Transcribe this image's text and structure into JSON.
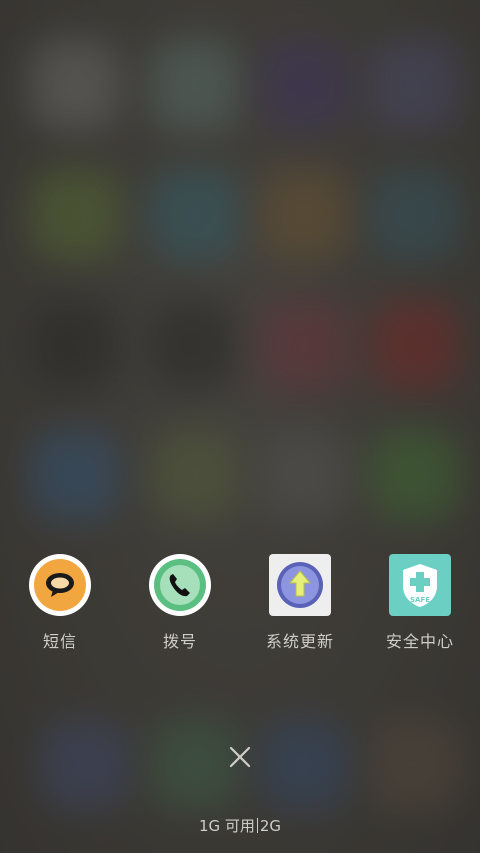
{
  "recent_apps": [
    {
      "label": "短信",
      "icon": "message-bubble-icon"
    },
    {
      "label": "拨号",
      "icon": "phone-handset-icon"
    },
    {
      "label": "系统更新",
      "icon": "upgrade-arrow-icon"
    },
    {
      "label": "安全中心",
      "icon": "safe-shield-icon"
    }
  ],
  "close_icon": "close-icon",
  "memory": {
    "available": "1G 可用",
    "total": "2G"
  },
  "colors": {
    "label_text": "#cfcdc8",
    "sms_orange": "#f1a640",
    "dialer_green": "#5cbf82",
    "update_purple": "#7e85d6",
    "security_teal": "#6ccfc4"
  }
}
